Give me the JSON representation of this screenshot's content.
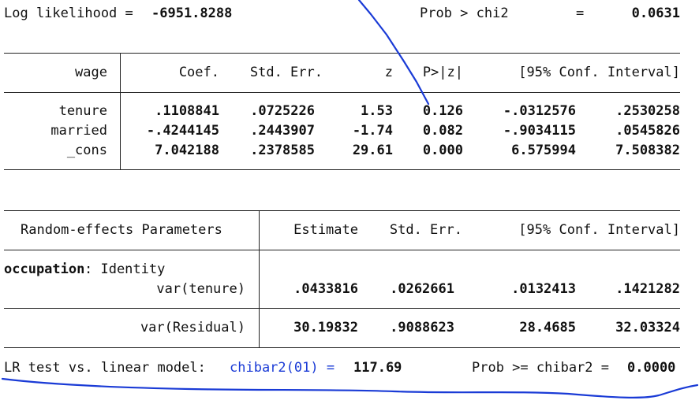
{
  "header": {
    "loglik_label": "Log likelihood = ",
    "loglik_value": "-6951.8288",
    "prob_label": "Prob > chi2",
    "eq": "=",
    "prob_value": "0.0631"
  },
  "fixed": {
    "depvar": "wage",
    "cols": [
      "Coef.",
      "Std. Err.",
      "z",
      "P>|z|",
      "[95% Conf. Interval]"
    ],
    "rows": [
      {
        "name": "tenure",
        "coef": ".1108841",
        "se": ".0725226",
        "z": "1.53",
        "p": "0.126",
        "lo": "-.0312576",
        "hi": ".2530258"
      },
      {
        "name": "married",
        "coef": "-.4244145",
        "se": ".2443907",
        "z": "-1.74",
        "p": "0.082",
        "lo": "-.9034115",
        "hi": ".0545826"
      },
      {
        "name": "_cons",
        "coef": "7.042188",
        "se": ".2378585",
        "z": "29.61",
        "p": "0.000",
        "lo": "6.575994",
        "hi": "7.508382"
      }
    ]
  },
  "random": {
    "header": "Random-effects Parameters",
    "cols": [
      "Estimate",
      "Std. Err.",
      "[95% Conf. Interval]"
    ],
    "group_name": "occupation",
    "group_type": ": Identity",
    "rows": [
      {
        "name": "var(tenure)",
        "est": ".0433816",
        "se": ".0262661",
        "lo": ".0132413",
        "hi": ".1421282"
      },
      {
        "name": "var(Residual)",
        "est": "30.19832",
        "se": ".9088623",
        "lo": "28.4685",
        "hi": "32.03324"
      }
    ]
  },
  "lrtest": {
    "label": "LR test vs. linear model: ",
    "stat": "chibar2(01) =",
    "value": "117.69",
    "prob_label": "Prob >= chibar2 = ",
    "prob_value": "0.0000"
  },
  "annotation_color": "#1a3bd6"
}
